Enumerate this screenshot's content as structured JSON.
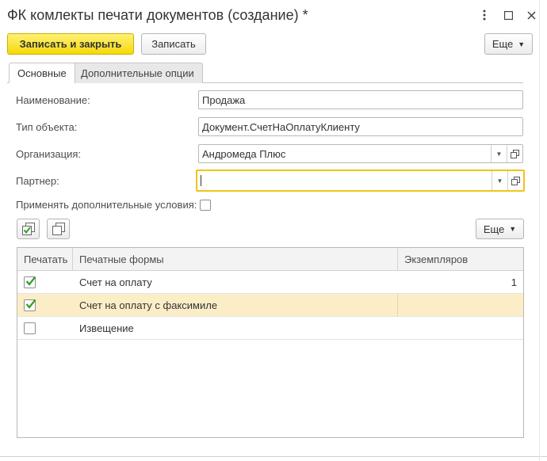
{
  "window": {
    "title": "ФК комлекты печати документов (создание) *"
  },
  "toolbar": {
    "save_close_label": "Записать и закрыть",
    "save_label": "Записать",
    "more_label": "Еще"
  },
  "tabs": [
    {
      "label": "Основные",
      "active": true
    },
    {
      "label": "Дополнительные опции",
      "active": false
    }
  ],
  "form": {
    "name": {
      "label": "Наименование:",
      "value": "Продажа"
    },
    "object_type": {
      "label": "Тип объекта:",
      "value": "Документ.СчетНаОплатуКлиенту"
    },
    "organization": {
      "label": "Организация:",
      "value": "Андромеда Плюс"
    },
    "partner": {
      "label": "Партнер:",
      "value": ""
    },
    "extra_conditions": {
      "label": "Применять дополнительные условия:",
      "checked": false
    }
  },
  "table_toolbar": {
    "more_label": "Еще"
  },
  "table": {
    "columns": [
      "Печатать",
      "Печатные формы",
      "Экземпляров"
    ],
    "rows": [
      {
        "print": true,
        "form": "Счет на оплату",
        "copies": "1",
        "selected": false
      },
      {
        "print": true,
        "form": "Счет на оплату с факсимиле",
        "copies": "",
        "selected": true
      },
      {
        "print": false,
        "form": "Извещение",
        "copies": "",
        "selected": false
      }
    ]
  },
  "colors": {
    "accent": "#f5d90a",
    "selected_row": "#fbeec7",
    "focus_border": "#f0c419",
    "check_green": "#3a9b2e"
  }
}
